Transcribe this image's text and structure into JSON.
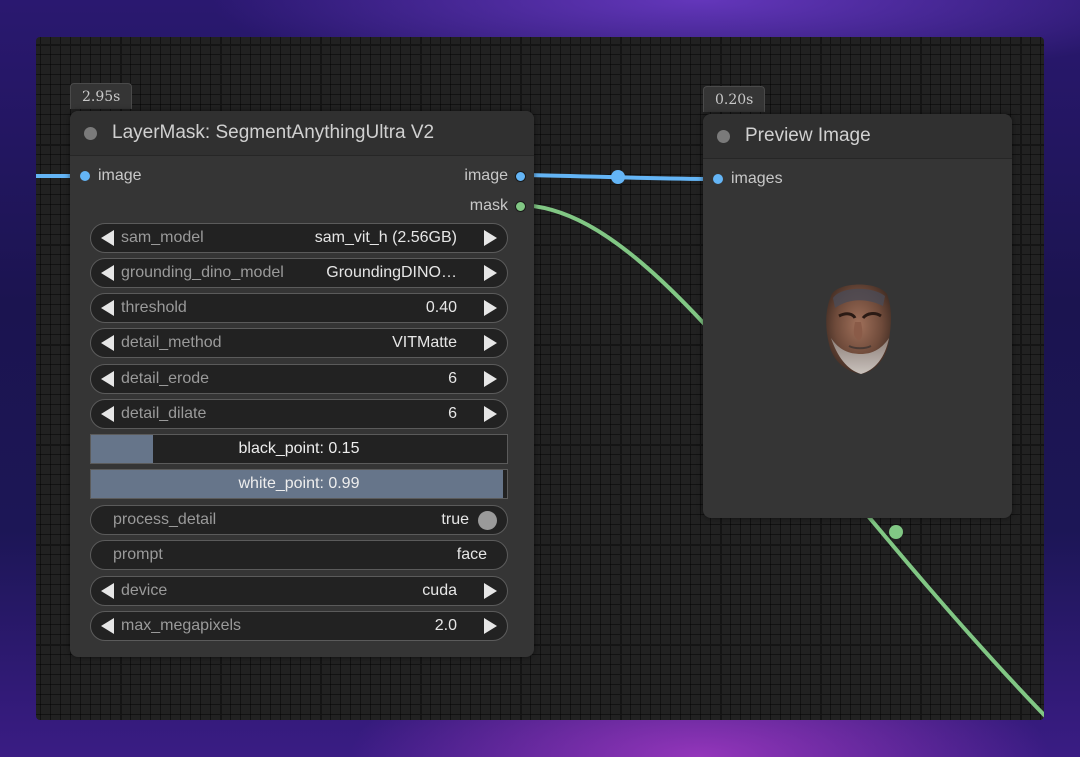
{
  "colors": {
    "image_link": "#64b5f6",
    "mask_link": "#81c784",
    "slider_fill": "#66758a",
    "node_bg": "#353535"
  },
  "nodes": {
    "segment": {
      "time_badge": "2.95s",
      "title": "LayerMask: SegmentAnythingUltra V2",
      "inputs": [
        {
          "label": "image",
          "type": "IMAGE"
        }
      ],
      "outputs": [
        {
          "label": "image",
          "type": "IMAGE"
        },
        {
          "label": "mask",
          "type": "MASK"
        }
      ],
      "widgets": {
        "sam_model": {
          "name": "sam_model",
          "value": "sam_vit_h (2.56GB)"
        },
        "grounding_dino_model": {
          "name": "grounding_dino_model",
          "value": "GroundingDINO…"
        },
        "threshold": {
          "name": "threshold",
          "value": "0.40"
        },
        "detail_method": {
          "name": "detail_method",
          "value": "VITMatte"
        },
        "detail_erode": {
          "name": "detail_erode",
          "value": "6"
        },
        "detail_dilate": {
          "name": "detail_dilate",
          "value": "6"
        },
        "black_point": {
          "label": "black_point: 0.15",
          "fraction": 0.15
        },
        "white_point": {
          "label": "white_point: 0.99",
          "fraction": 0.99
        },
        "process_detail": {
          "name": "process_detail",
          "value": "true"
        },
        "prompt": {
          "name": "prompt",
          "value": "face"
        },
        "device": {
          "name": "device",
          "value": "cuda"
        },
        "max_megapixels": {
          "name": "max_megapixels",
          "value": "2.0"
        }
      }
    },
    "preview": {
      "time_badge": "0.20s",
      "title": "Preview Image",
      "inputs": [
        {
          "label": "images",
          "type": "IMAGE"
        }
      ],
      "preview_content": "segmented-face-image"
    }
  }
}
